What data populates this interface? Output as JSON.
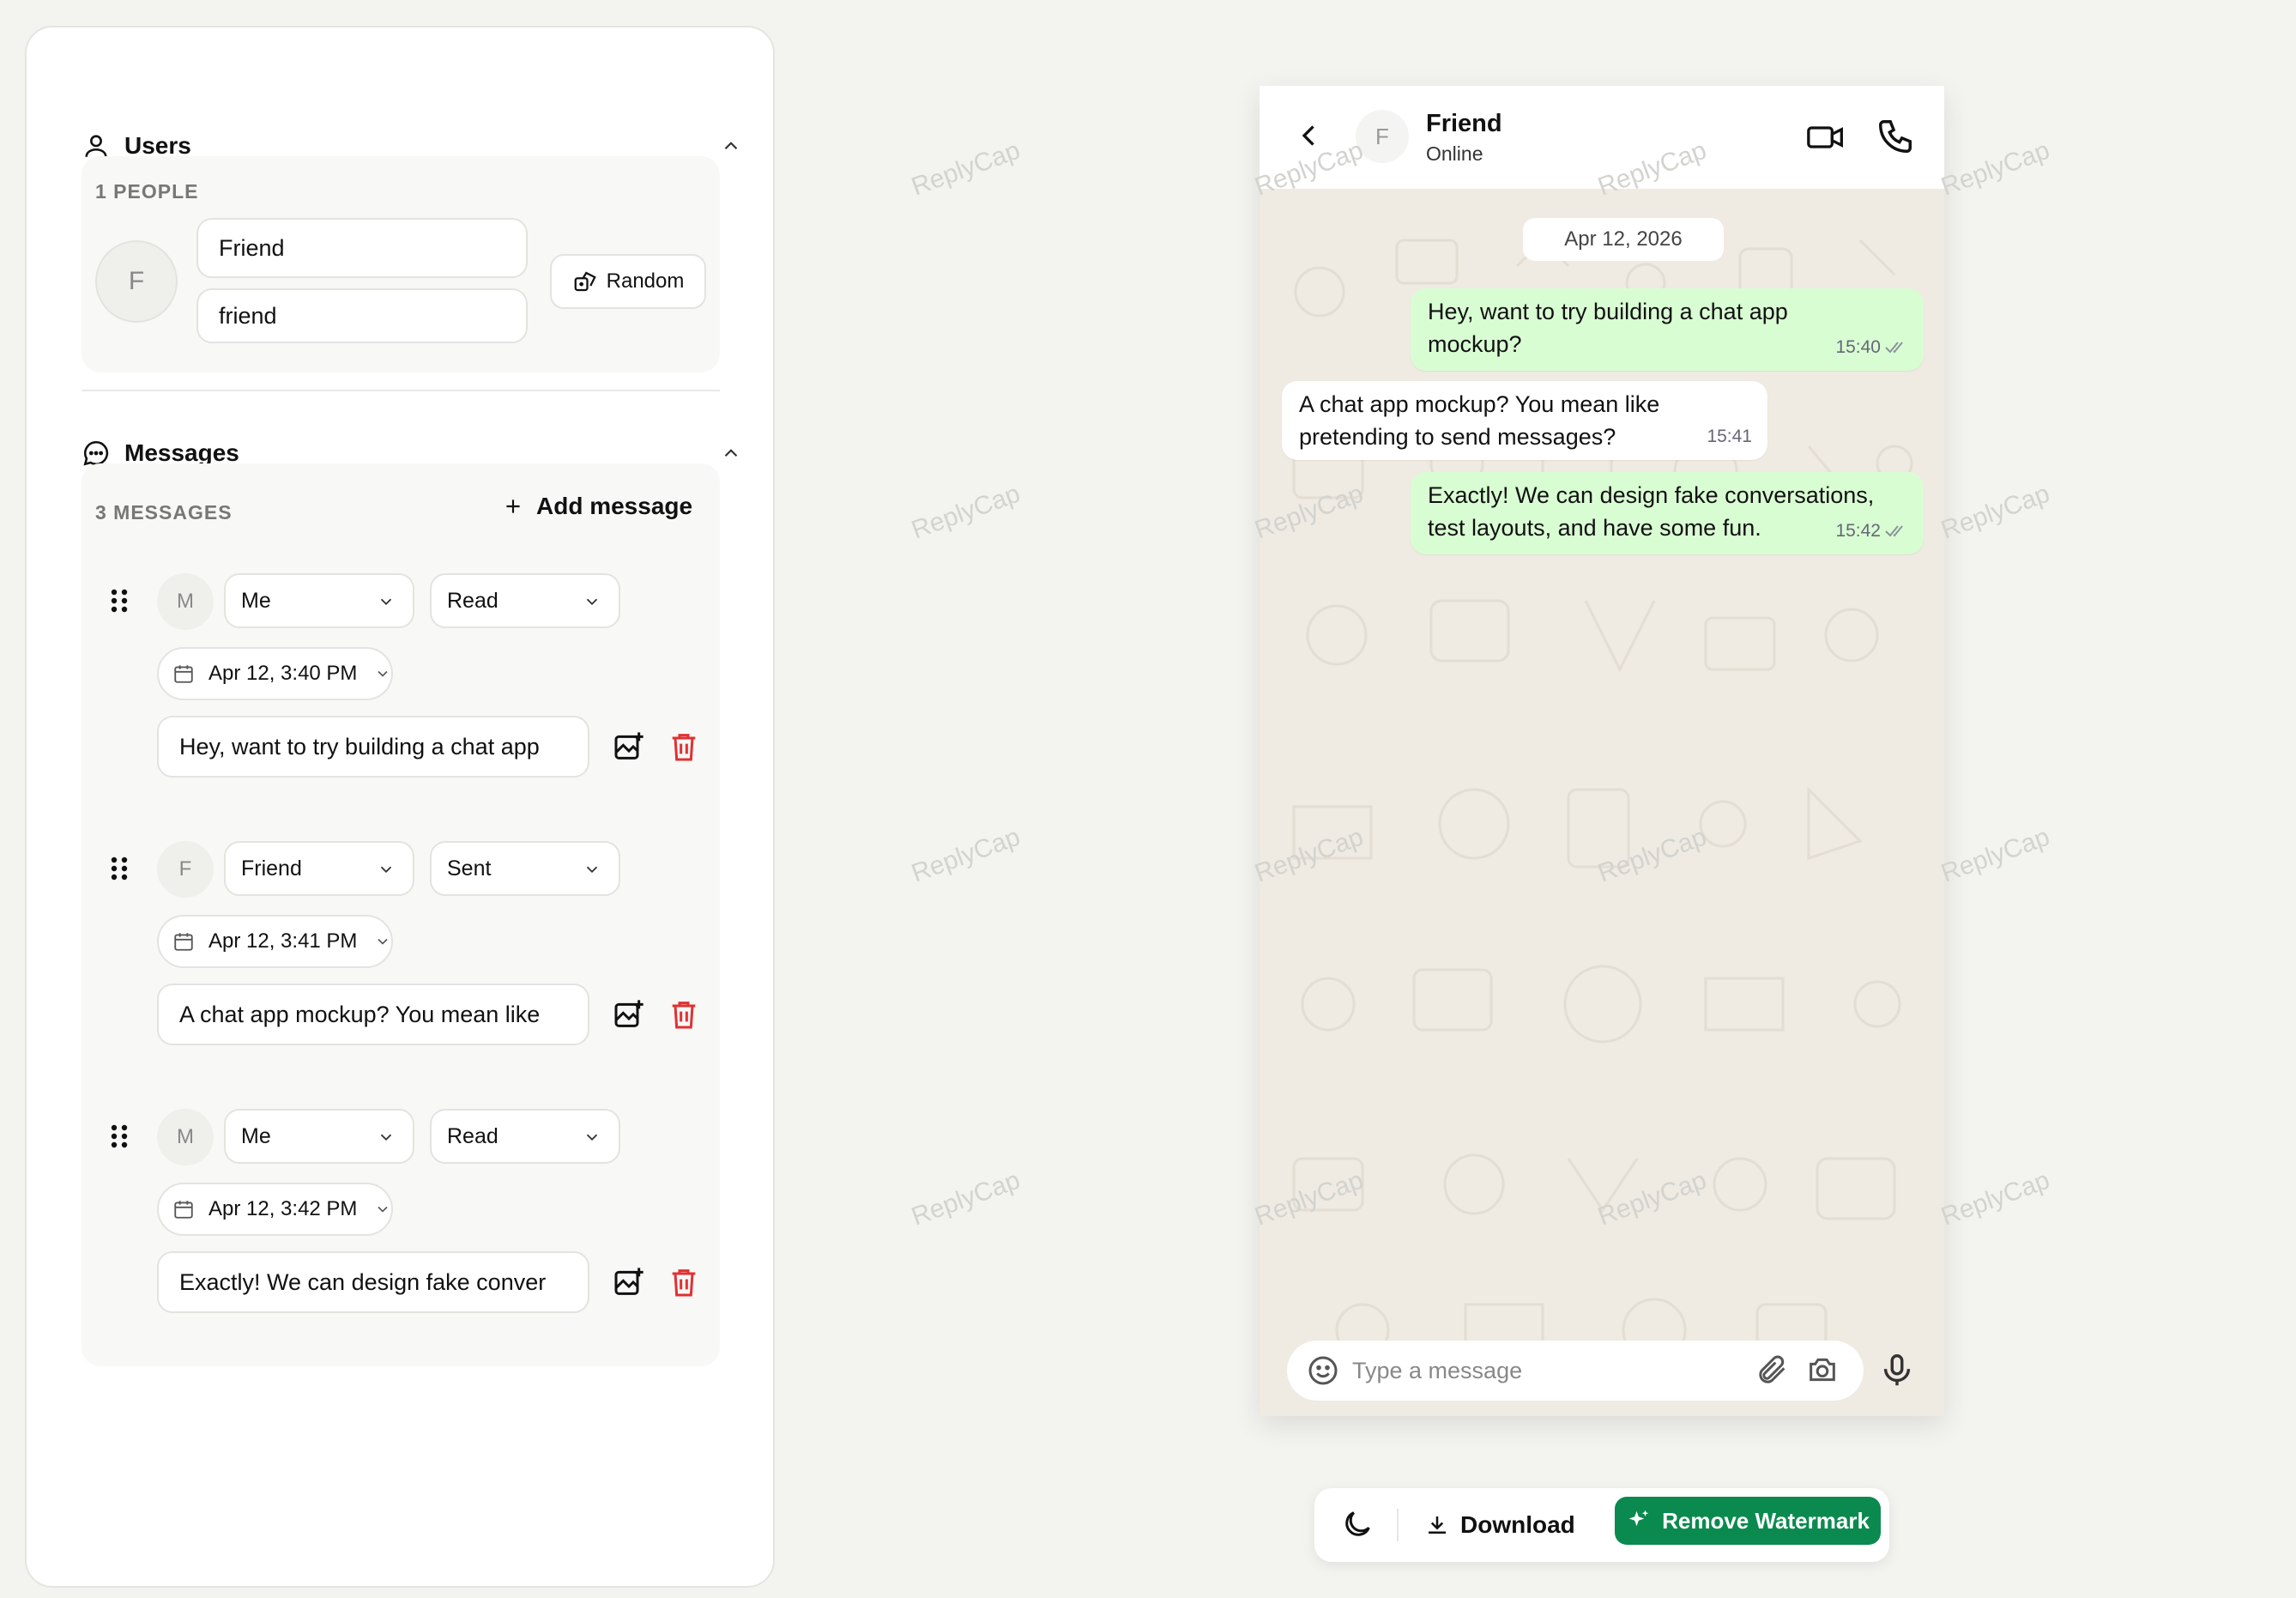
{
  "users_section": {
    "title": "Users",
    "count_label": "1 PEOPLE",
    "person": {
      "avatar_letter": "F",
      "display_name": "Friend",
      "username": "friend",
      "random_label": "Random"
    }
  },
  "messages_section": {
    "title": "Messages",
    "count_label": "3 MESSAGES",
    "add_label": "Add message",
    "items": [
      {
        "avatar": "M",
        "sender": "Me",
        "status": "Read",
        "datetime": "Apr 12, 3:40 PM",
        "text": "Hey, want to try building a chat app"
      },
      {
        "avatar": "F",
        "sender": "Friend",
        "status": "Sent",
        "datetime": "Apr 12, 3:41 PM",
        "text": "A chat app mockup? You mean like"
      },
      {
        "avatar": "M",
        "sender": "Me",
        "status": "Read",
        "datetime": "Apr 12, 3:42 PM",
        "text": "Exactly! We can design fake conver"
      }
    ]
  },
  "preview": {
    "contact_letter": "F",
    "contact_name": "Friend",
    "contact_status": "Online",
    "date_label": "Apr 12, 2026",
    "messages": [
      {
        "direction": "out",
        "line1": "Hey, want to try building a chat app",
        "line2": "mockup?",
        "time": "15:40",
        "ticks": "double"
      },
      {
        "direction": "in",
        "line1": "A chat app mockup? You mean like",
        "line2": "pretending to send messages?",
        "time": "15:41"
      },
      {
        "direction": "out",
        "line1": "Exactly! We can design fake conversations,",
        "line2": "test layouts, and have some fun.",
        "time": "15:42",
        "ticks": "double"
      }
    ],
    "input_placeholder": "Type a message"
  },
  "toolbar": {
    "download_label": "Download",
    "remove_label": "Remove Watermark"
  },
  "watermark_text": "ReplyCap",
  "colors": {
    "accent_green": "#0b8a4f",
    "bubble_out": "#d9fdd3",
    "bubble_in": "#ffffff",
    "chat_bg": "#efeae2",
    "delete_red": "#e03131"
  },
  "icons": [
    "user-icon",
    "chat-bubble-icon",
    "chevron-up-icon",
    "dice-icon",
    "plus-icon",
    "drag-handle-icon",
    "calendar-icon",
    "chevron-down-icon",
    "image-add-icon",
    "trash-icon",
    "back-arrow-icon",
    "video-call-icon",
    "phone-icon",
    "emoji-icon",
    "paperclip-icon",
    "camera-icon",
    "microphone-icon",
    "moon-icon",
    "download-icon",
    "sparkle-icon",
    "double-check-icon"
  ]
}
